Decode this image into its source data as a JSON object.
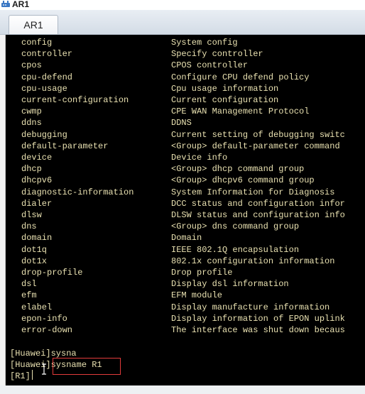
{
  "window": {
    "title": "AR1"
  },
  "tabs": [
    {
      "label": "AR1",
      "active": true
    }
  ],
  "terminal": {
    "help_rows": [
      {
        "command": "config",
        "description": "System config"
      },
      {
        "command": "controller",
        "description": "Specify controller"
      },
      {
        "command": "cpos",
        "description": "CPOS controller"
      },
      {
        "command": "cpu-defend",
        "description": "Configure CPU defend policy"
      },
      {
        "command": "cpu-usage",
        "description": "Cpu usage information"
      },
      {
        "command": "current-configuration",
        "description": "Current configuration"
      },
      {
        "command": "cwmp",
        "description": "CPE WAN Management Protocol"
      },
      {
        "command": "ddns",
        "description": "DDNS"
      },
      {
        "command": "debugging",
        "description": "Current setting of debugging switc"
      },
      {
        "command": "default-parameter",
        "description": "<Group> default-parameter command"
      },
      {
        "command": "device",
        "description": "Device info"
      },
      {
        "command": "dhcp",
        "description": "<Group> dhcp command group"
      },
      {
        "command": "dhcpv6",
        "description": "<Group> dhcpv6 command group"
      },
      {
        "command": "diagnostic-information",
        "description": "System Information for Diagnosis"
      },
      {
        "command": "dialer",
        "description": "DCC status and configuration infor"
      },
      {
        "command": "dlsw",
        "description": "DLSW status and configuration info"
      },
      {
        "command": "dns",
        "description": "<Group> dns command group"
      },
      {
        "command": "domain",
        "description": "Domain"
      },
      {
        "command": "dot1q",
        "description": "IEEE 802.1Q encapsulation"
      },
      {
        "command": "dot1x",
        "description": "802.1x configuration information"
      },
      {
        "command": "drop-profile",
        "description": "Drop profile"
      },
      {
        "command": "dsl",
        "description": "Display dsl information"
      },
      {
        "command": "efm",
        "description": "EFM module"
      },
      {
        "command": "elabel",
        "description": "Display manufacture information"
      },
      {
        "command": "epon-info",
        "description": "Display information of EPON uplink"
      },
      {
        "command": "error-down",
        "description": "The interface was shut down becaus"
      }
    ],
    "prompt_lines": [
      "[Huawei]sysna",
      "[Huawei]sysname R1",
      "[R1]"
    ]
  },
  "colors": {
    "terminal_bg": "#000000",
    "terminal_fg": "#e8e0b0",
    "highlight_border": "#e23b3b"
  },
  "icons": {
    "app_icon": "router-app-icon",
    "text_cursor": "ibeam-cursor-icon"
  }
}
